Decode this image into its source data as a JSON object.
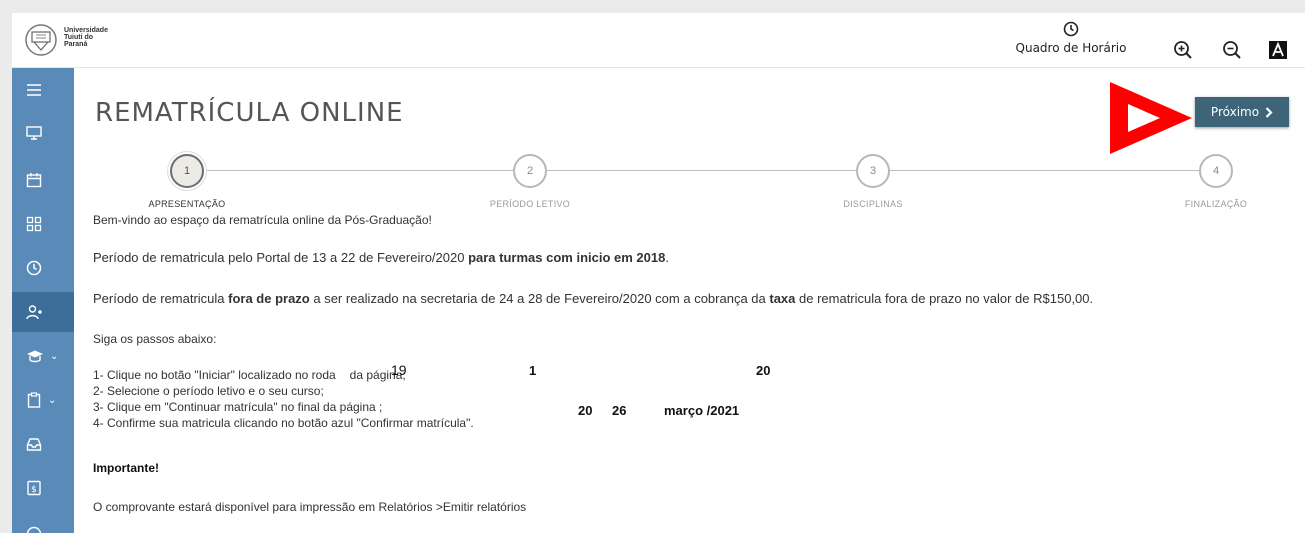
{
  "header": {
    "logo_lines": [
      "Universidade",
      "Tuiuti do",
      "Paraná"
    ],
    "schedule_label": "Quadro de Horário"
  },
  "page": {
    "title": "REMATRÍCULA ONLINE",
    "next_label": "Próximo"
  },
  "steps": [
    {
      "num": "1",
      "label": "APRESENTAÇÃO"
    },
    {
      "num": "2",
      "label": "PERÍODO LETIVO"
    },
    {
      "num": "3",
      "label": "DISCIPLINAS"
    },
    {
      "num": "4",
      "label": "FINALIZAÇÃO"
    }
  ],
  "body": {
    "welcome": "Bem-vindo ao espaço da rematrícula online da Pós-Graduação!",
    "p1_a": "Período de rematricula pelo Portal de 13 a 22 de Fevereiro/2020 ",
    "p1_b": "para turmas com inicio em 2018",
    "p1_c": ".",
    "p2_a": "Período de rematricula ",
    "p2_b": "fora de prazo",
    "p2_c": " a ser realizado na secretaria de 24 a 28 de Fevereiro/2020 com a cobrança da ",
    "p2_d": "taxa",
    "p2_e": " de rematricula fora de prazo no valor de R$150,00.",
    "steps_intro": "Siga os passos abaixo:",
    "step_lines": [
      "1- Clique no botão  \"Iniciar\" localizado no roda",
      "2- Selecione o período letivo e o seu curso;",
      "3- Clique em \"Continuar matrícula\" no final da página ;",
      "4- Confirme sua matricula clicando  no botão azul  \"Confirmar matrícula\"."
    ],
    "step1_tail": "da página;",
    "overlay": {
      "n19": "19",
      "n1": "1",
      "n20a": "20",
      "n20b": "20",
      "n26": "26",
      "month": "março /2021"
    },
    "important": "Importante!",
    "receipt": "O comprovante estará disponível para impressão em Relatórios >Emitir relatórios"
  },
  "colors": {
    "sidebar": "#5a8bb8",
    "sidebar_active": "#3c6e99",
    "button": "#3d6478",
    "arrow": "#ff0000"
  }
}
